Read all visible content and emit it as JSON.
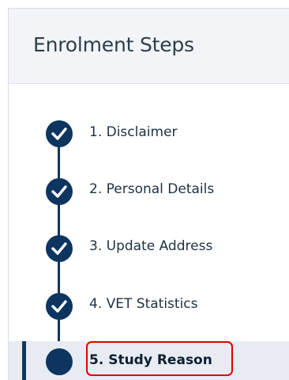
{
  "panel": {
    "title": "Enrolment Steps"
  },
  "steps": [
    {
      "label": "1. Disclaimer",
      "status": "completed",
      "icon": "check-icon"
    },
    {
      "label": "2. Personal Details",
      "status": "completed",
      "icon": "check-icon"
    },
    {
      "label": "3. Update Address",
      "status": "completed",
      "icon": "check-icon"
    },
    {
      "label": "4. VET Statistics",
      "status": "completed",
      "icon": "check-icon"
    },
    {
      "label": "5. Study Reason",
      "status": "current",
      "icon": "current-step-dot-icon"
    }
  ],
  "colors": {
    "accent": "#0d3560",
    "highlight": "#e00000",
    "header_bg": "#f2f4f7",
    "active_bg": "#e8ecf2"
  }
}
